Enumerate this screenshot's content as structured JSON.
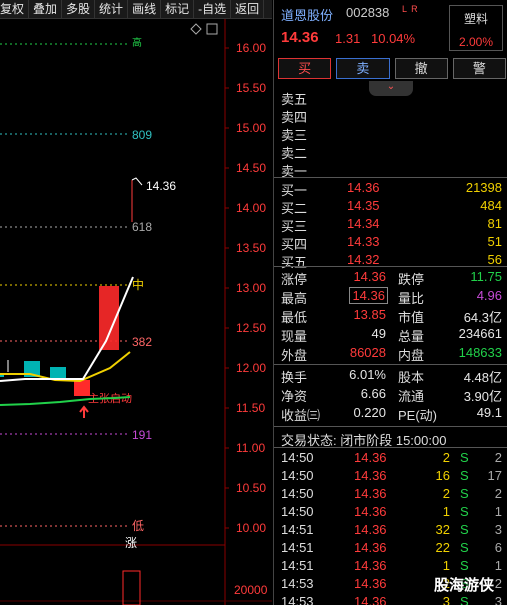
{
  "toolbar": {
    "items": [
      "复权",
      "叠加",
      "多股",
      "统计",
      "画线",
      "标记",
      "-自选",
      "返回"
    ]
  },
  "chart": {
    "y_ticks": [
      "16.00",
      "15.50",
      "15.00",
      "14.50",
      "14.00",
      "13.50",
      "13.00",
      "12.50",
      "12.00",
      "11.50",
      "11.00",
      "10.50",
      "10.00"
    ],
    "volume_tick": "20000",
    "level_labels": {
      "top_marker": "高",
      "l809": "809",
      "close": "14.36",
      "l618": "618",
      "mid": "中",
      "l382": "382",
      "l191": "191",
      "low": "低",
      "zhang": "涨",
      "annotation": "主张启动"
    },
    "colors": {
      "up": "#ff2a2a",
      "down": "#00b3b3",
      "ma_white": "#ffffff",
      "ma_yellow": "#f0d000",
      "ma_green": "#21d14a"
    }
  },
  "quote": {
    "name": "道恩股份",
    "code": "002838",
    "flags": "L R",
    "price": "14.36",
    "change": "1.31",
    "change_pct": "10.04%",
    "sector": "塑料",
    "sector_pct": "2.00%"
  },
  "actions": {
    "buy": "买",
    "sell": "卖",
    "cancel": "撤",
    "alert": "警"
  },
  "sell_book": [
    {
      "label": "卖五",
      "price": "",
      "vol": ""
    },
    {
      "label": "卖四",
      "price": "",
      "vol": ""
    },
    {
      "label": "卖三",
      "price": "",
      "vol": ""
    },
    {
      "label": "卖二",
      "price": "",
      "vol": ""
    },
    {
      "label": "卖一",
      "price": "",
      "vol": ""
    }
  ],
  "buy_book": [
    {
      "label": "买一",
      "price": "14.36",
      "vol": "21398"
    },
    {
      "label": "买二",
      "price": "14.35",
      "vol": "484"
    },
    {
      "label": "买三",
      "price": "14.34",
      "vol": "81"
    },
    {
      "label": "买四",
      "price": "14.33",
      "vol": "51"
    },
    {
      "label": "买五",
      "price": "14.32",
      "vol": "56"
    }
  ],
  "stats": [
    {
      "l1": "涨停",
      "v1": "14.36",
      "c1": "red",
      "l2": "跌停",
      "v2": "11.75",
      "c2": "green"
    },
    {
      "l1": "最高",
      "v1": "14.36",
      "c1": "red",
      "l2": "量比",
      "v2": "4.96",
      "c2": "purple",
      "boxed": true
    },
    {
      "l1": "最低",
      "v1": "13.85",
      "c1": "red",
      "l2": "市值",
      "v2": "64.3亿",
      "c2": "white"
    },
    {
      "l1": "现量",
      "v1": "49",
      "c1": "white",
      "l2": "总量",
      "v2": "234661",
      "c2": "white"
    },
    {
      "l1": "外盘",
      "v1": "86028",
      "c1": "red",
      "l2": "内盘",
      "v2": "148633",
      "c2": "green"
    },
    {
      "l1": "换手",
      "v1": "6.01%",
      "c1": "white",
      "l2": "股本",
      "v2": "4.48亿",
      "c2": "white"
    },
    {
      "l1": "净资",
      "v1": "6.66",
      "c1": "white",
      "l2": "流通",
      "v2": "3.90亿",
      "c2": "white"
    },
    {
      "l1": "收益㈢",
      "v1": "0.220",
      "c1": "white",
      "l2": "PE(动)",
      "v2": "49.1",
      "c2": "white"
    }
  ],
  "status": "交易状态: 闭市阶段 15:00:00",
  "ticks": [
    {
      "time": "14:50",
      "price": "14.36",
      "vol": "2",
      "side": "S",
      "n": "2"
    },
    {
      "time": "14:50",
      "price": "14.36",
      "vol": "16",
      "side": "S",
      "n": "17"
    },
    {
      "time": "14:50",
      "price": "14.36",
      "vol": "2",
      "side": "S",
      "n": "2"
    },
    {
      "time": "14:50",
      "price": "14.36",
      "vol": "1",
      "side": "S",
      "n": "1"
    },
    {
      "time": "14:51",
      "price": "14.36",
      "vol": "32",
      "side": "S",
      "n": "3"
    },
    {
      "time": "14:51",
      "price": "14.36",
      "vol": "22",
      "side": "S",
      "n": "6"
    },
    {
      "time": "14:51",
      "price": "14.36",
      "vol": "1",
      "side": "S",
      "n": "1"
    },
    {
      "time": "14:53",
      "price": "14.36",
      "vol": "2",
      "side": "S",
      "n": "2"
    },
    {
      "time": "14:53",
      "price": "14.36",
      "vol": "3",
      "side": "S",
      "n": "3"
    }
  ],
  "watermark": "股海游侠"
}
